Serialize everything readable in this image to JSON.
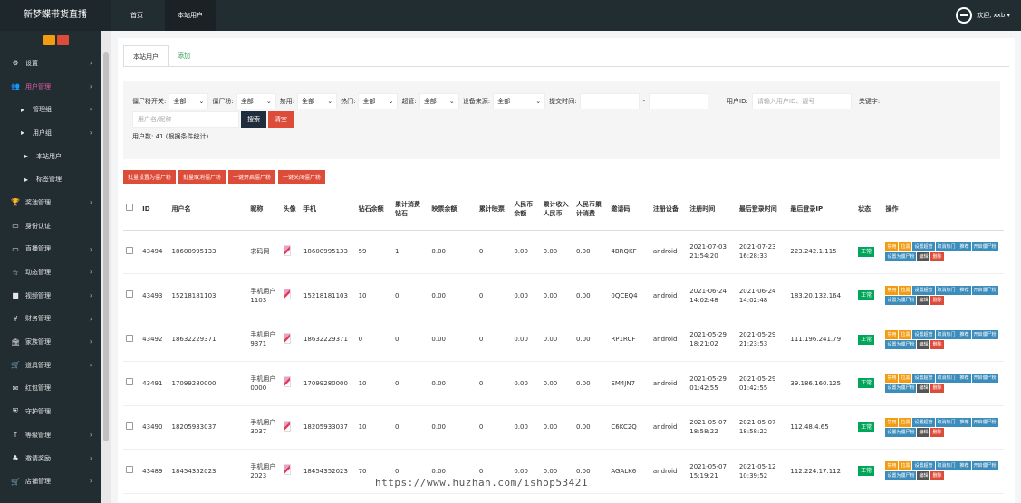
{
  "app": {
    "brand": "新梦蝶带货直播"
  },
  "topnav": {
    "tabs": [
      "首页",
      "本站用户"
    ],
    "welcome": "欢迎, xxb ▾"
  },
  "sidebar": {
    "items": [
      {
        "icon": "⚙",
        "label": "设置",
        "arrow": "›"
      },
      {
        "icon": "👥",
        "label": "用户管理",
        "arrow": "›"
      },
      {
        "icon": "▸",
        "label": "管理组",
        "arrow": "›"
      },
      {
        "icon": "▸",
        "label": "用户组",
        "arrow": "›"
      },
      {
        "icon": "▸",
        "label": "本站用户",
        "arrow": ""
      },
      {
        "icon": "▸",
        "label": "标签管理",
        "arrow": ""
      },
      {
        "icon": "🏆",
        "label": "奖池管理",
        "arrow": "›"
      },
      {
        "icon": "▭",
        "label": "身份认证",
        "arrow": ""
      },
      {
        "icon": "▭",
        "label": "直播管理",
        "arrow": "›"
      },
      {
        "icon": "☆",
        "label": "动态管理",
        "arrow": "›"
      },
      {
        "icon": "■",
        "label": "视频管理",
        "arrow": "›"
      },
      {
        "icon": "¥",
        "label": "财务管理",
        "arrow": "›"
      },
      {
        "icon": "🏛",
        "label": "家族管理",
        "arrow": "›"
      },
      {
        "icon": "🛒",
        "label": "道具管理",
        "arrow": "›"
      },
      {
        "icon": "✉",
        "label": "红包管理",
        "arrow": ""
      },
      {
        "icon": "⛨",
        "label": "守护管理",
        "arrow": ""
      },
      {
        "icon": "↑",
        "label": "等级管理",
        "arrow": "›"
      },
      {
        "icon": "♣",
        "label": "邀请奖励",
        "arrow": "›"
      },
      {
        "icon": "🛒",
        "label": "店铺管理",
        "arrow": "›"
      }
    ]
  },
  "page": {
    "tabs": [
      "本站用户",
      "添加"
    ],
    "filters": {
      "zombie_label": "僵尸粉开关:",
      "zombie_value": "全部",
      "zombie_fans_label": "僵尸粉:",
      "zombie_fans_value": "全部",
      "ban_label": "禁用:",
      "ban_value": "全部",
      "hot_label": "热门:",
      "hot_value": "全部",
      "super_label": "超管:",
      "super_value": "全部",
      "device_label": "设备来源:",
      "device_value": "全部",
      "time_label": "提交时间:",
      "time_sep": "-",
      "uid_label": "用户ID:",
      "uid_placeholder": "请输入用户ID、靓号",
      "keyword_label": "关键字:",
      "name_placeholder": "用户名/昵称",
      "search_btn": "搜索",
      "clear_btn": "清空",
      "caret": "⌄"
    },
    "count_text": "用户数: 41 (根据条件统计)",
    "bulk_actions": [
      "批量设置为僵尸粉",
      "批量取消僵尸粉",
      "一键开启僵尸粉",
      "一键关闭僵尸粉"
    ]
  },
  "table": {
    "headers": [
      "ID",
      "用户名",
      "昵称",
      "头像",
      "手机",
      "钻石余额",
      "累计消费钻石",
      "映票余额",
      "累计映票",
      "人民币余额",
      "累计收入人民币",
      "人民币累计消费",
      "邀请码",
      "注册设备",
      "注册时间",
      "最后登录时间",
      "最后登录IP",
      "状态",
      "操作"
    ],
    "rows": [
      {
        "id": "43494",
        "username": "18600995133",
        "nickname": "求码网",
        "phone": "18600995133",
        "diamond": "59",
        "consume": "1",
        "ticket": "0.00",
        "ticket_total": "0",
        "rmb": "0.00",
        "rmb_income": "0.00",
        "rmb_consume": "0.00",
        "code": "4BRQKF",
        "device": "android",
        "reg_time": "2021-07-03 21:54:20",
        "last_time": "2021-07-23 16:28:33",
        "ip": "223.242.1.115",
        "status": "正常"
      },
      {
        "id": "43493",
        "username": "15218181103",
        "nickname": "手机用户1103",
        "phone": "15218181103",
        "diamond": "10",
        "consume": "0",
        "ticket": "0.00",
        "ticket_total": "0",
        "rmb": "0.00",
        "rmb_income": "0.00",
        "rmb_consume": "0.00",
        "code": "0QCEQ4",
        "device": "android",
        "reg_time": "2021-06-24 14:02:48",
        "last_time": "2021-06-24 14:02:48",
        "ip": "183.20.132.164",
        "status": "正常"
      },
      {
        "id": "43492",
        "username": "18632229371",
        "nickname": "手机用户9371",
        "phone": "18632229371",
        "diamond": "0",
        "consume": "0",
        "ticket": "0.00",
        "ticket_total": "0",
        "rmb": "0.00",
        "rmb_income": "0.00",
        "rmb_consume": "0.00",
        "code": "RP1RCF",
        "device": "android",
        "reg_time": "2021-05-29 18:21:02",
        "last_time": "2021-05-29 21:23:53",
        "ip": "111.196.241.79",
        "status": "正常"
      },
      {
        "id": "43491",
        "username": "17099280000",
        "nickname": "手机用户0000",
        "phone": "17099280000",
        "diamond": "10",
        "consume": "0",
        "ticket": "0.00",
        "ticket_total": "0",
        "rmb": "0.00",
        "rmb_income": "0.00",
        "rmb_consume": "0.00",
        "code": "EM4JN7",
        "device": "android",
        "reg_time": "2021-05-29 01:42:55",
        "last_time": "2021-05-29 01:42:55",
        "ip": "39.186.160.125",
        "status": "正常"
      },
      {
        "id": "43490",
        "username": "18205933037",
        "nickname": "手机用户3037",
        "phone": "18205933037",
        "diamond": "10",
        "consume": "0",
        "ticket": "0.00",
        "ticket_total": "0",
        "rmb": "0.00",
        "rmb_income": "0.00",
        "rmb_consume": "0.00",
        "code": "C6KC2Q",
        "device": "android",
        "reg_time": "2021-05-07 18:58:22",
        "last_time": "2021-05-07 18:58:22",
        "ip": "112.48.4.65",
        "status": "正常"
      },
      {
        "id": "43489",
        "username": "18454352023",
        "nickname": "手机用户2023",
        "phone": "18454352023",
        "diamond": "70",
        "consume": "0",
        "ticket": "0.00",
        "ticket_total": "0",
        "rmb": "0.00",
        "rmb_income": "0.00",
        "rmb_consume": "0.00",
        "code": "AGALK6",
        "device": "android",
        "reg_time": "2021-05-07 15:19:21",
        "last_time": "2021-05-12 10:39:52",
        "ip": "112.224.17.112",
        "status": "正常"
      }
    ],
    "row_actions": [
      "禁用",
      "拉黑",
      "设置超管",
      "取消热门",
      "推荐",
      "开启僵尸粉",
      "设置为僵尸粉",
      "编辑",
      "删除"
    ]
  },
  "watermark": "https://www.huzhan.com/ishop53421",
  "colors": {
    "topbar": "#222d32",
    "danger": "#dd4b39",
    "success": "#00a65a",
    "warning": "#f39c12",
    "primary": "#3c8dbc"
  }
}
